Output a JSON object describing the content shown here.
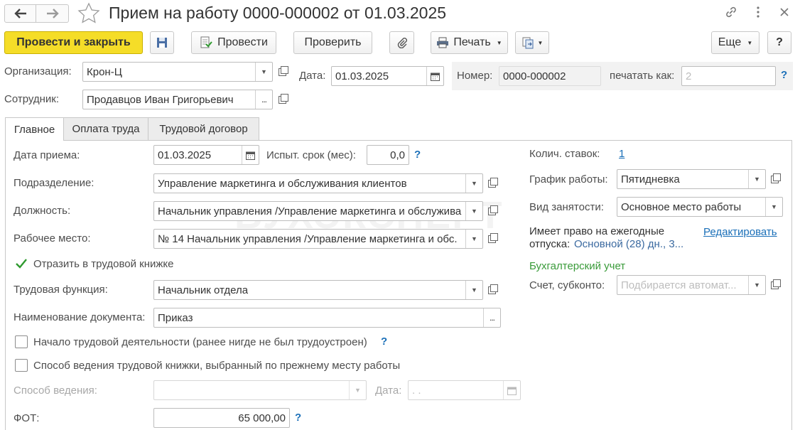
{
  "window": {
    "title": "Прием на работу 0000-000002 от 01.03.2025"
  },
  "toolbar": {
    "post_close": "Провести и закрыть",
    "post": "Провести",
    "check": "Проверить",
    "print": "Печать",
    "more": "Еще",
    "help": "?"
  },
  "header": {
    "org_label": "Организация:",
    "org_value": "Крон-Ц",
    "date_label": "Дата:",
    "date_value": "01.03.2025",
    "number_label": "Номер:",
    "number_value": "0000-000002",
    "print_as_label": "печатать как:",
    "print_as_placeholder": "2",
    "employee_label": "Сотрудник:",
    "employee_value": "Продавцов Иван Григорьевич"
  },
  "tabs": [
    "Главное",
    "Оплата труда",
    "Трудовой договор"
  ],
  "main": {
    "hire_date_label": "Дата приема:",
    "hire_date_value": "01.03.2025",
    "probation_label": "Испыт. срок (мес):",
    "probation_value": "0,0",
    "department_label": "Подразделение:",
    "department_value": "Управление маркетинга и обслуживания клиентов",
    "position_label": "Должность:",
    "position_value": "Начальник управления /Управление маркетинга и обслужива",
    "workplace_label": "Рабочее место:",
    "workplace_value": "№ 14 Начальник управления /Управление маркетинга и обс.",
    "reflect_label": "Отразить в трудовой книжке",
    "function_label": "Трудовая функция:",
    "function_value": "Начальник отдела",
    "doc_name_label": "Наименование документа:",
    "doc_name_value": "Приказ",
    "start_career_label": "Начало трудовой деятельности (ранее нигде не был трудоустроен)",
    "method_prev_label": "Способ ведения трудовой книжки, выбранный по прежнему месту работы",
    "method_label": "Способ ведения:",
    "method_date_label": "Дата:",
    "method_date_value": " .  .",
    "fot_label": "ФОТ:",
    "fot_value": "65 000,00"
  },
  "right": {
    "rates_label": "Колич. ставок:",
    "rates_value": "1",
    "schedule_label": "График работы:",
    "schedule_value": "Пятидневка",
    "employment_label": "Вид занятости:",
    "employment_value": "Основное место работы",
    "vacation_title_1": "Имеет право на ежегодные",
    "vacation_title_2": "отпуска:",
    "vacation_value": "Основной (28) дн., 3...",
    "edit_link": "Редактировать",
    "accounting_title": "Бухгалтерский учет",
    "account_label": "Счет, субконто:",
    "account_placeholder": "Подбирается автомат..."
  },
  "watermark": "БУХЭКСПЕРТ",
  "colors": {
    "primary_button": "#f5dd28",
    "link": "#1a6fb8",
    "accounting_title": "#3a9b3a"
  }
}
